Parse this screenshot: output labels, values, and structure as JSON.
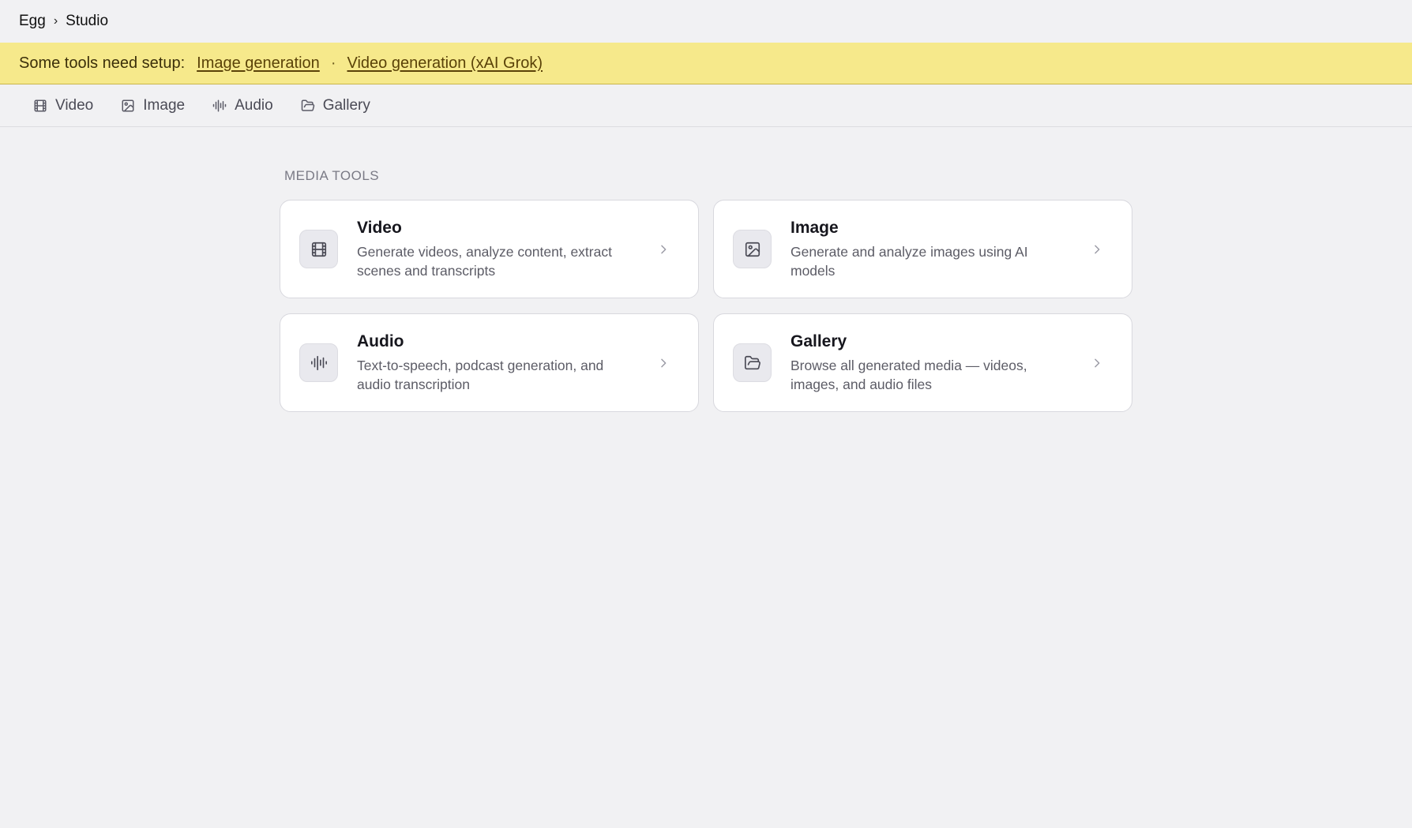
{
  "breadcrumb": {
    "root": "Egg",
    "separator": "›",
    "current": "Studio"
  },
  "banner": {
    "label": "Some tools need setup:",
    "links": [
      "Image generation",
      "Video generation (xAI Grok)"
    ],
    "separator": "·"
  },
  "tabs": [
    {
      "label": "Video",
      "icon": "film-icon"
    },
    {
      "label": "Image",
      "icon": "image-icon"
    },
    {
      "label": "Audio",
      "icon": "waveform-icon"
    },
    {
      "label": "Gallery",
      "icon": "folder-icon"
    }
  ],
  "section_title": "MEDIA TOOLS",
  "cards": [
    {
      "title": "Video",
      "description": "Generate videos, analyze content, extract scenes and transcripts",
      "icon": "film-icon"
    },
    {
      "title": "Image",
      "description": "Generate and analyze images using AI models",
      "icon": "image-icon"
    },
    {
      "title": "Audio",
      "description": "Text-to-speech, podcast generation, and audio transcription",
      "icon": "waveform-icon"
    },
    {
      "title": "Gallery",
      "description": "Browse all generated media — videos, images, and audio files",
      "icon": "folder-icon"
    }
  ],
  "colors": {
    "banner_bg": "#f6e98b",
    "page_bg": "#f1f1f3",
    "card_bg": "#ffffff"
  }
}
